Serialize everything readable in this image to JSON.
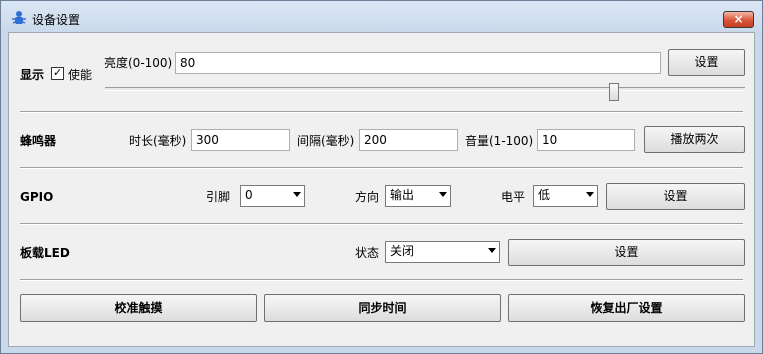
{
  "window": {
    "title": "设备设置",
    "close_label": "×"
  },
  "display": {
    "section_label": "显示",
    "enable_label": "使能",
    "enabled": true,
    "brightness_label": "亮度(0-100)",
    "brightness_value": "80",
    "set_button": "设置"
  },
  "buzzer": {
    "section_label": "蜂鸣器",
    "duration_label": "时长(毫秒)",
    "duration_value": "300",
    "interval_label": "间隔(毫秒)",
    "interval_value": "200",
    "volume_label": "音量(1-100)",
    "volume_value": "10",
    "play_button": "播放两次"
  },
  "gpio": {
    "section_label": "GPIO",
    "pin_label": "引脚",
    "pin_value": "0",
    "direction_label": "方向",
    "direction_value": "输出",
    "level_label": "电平",
    "level_value": "低",
    "set_button": "设置"
  },
  "led": {
    "section_label": "板载LED",
    "state_label": "状态",
    "state_value": "关闭",
    "set_button": "设置"
  },
  "actions": {
    "calibrate_touch": "校准触摸",
    "sync_time": "同步时间",
    "factory_reset": "恢复出厂设置"
  }
}
